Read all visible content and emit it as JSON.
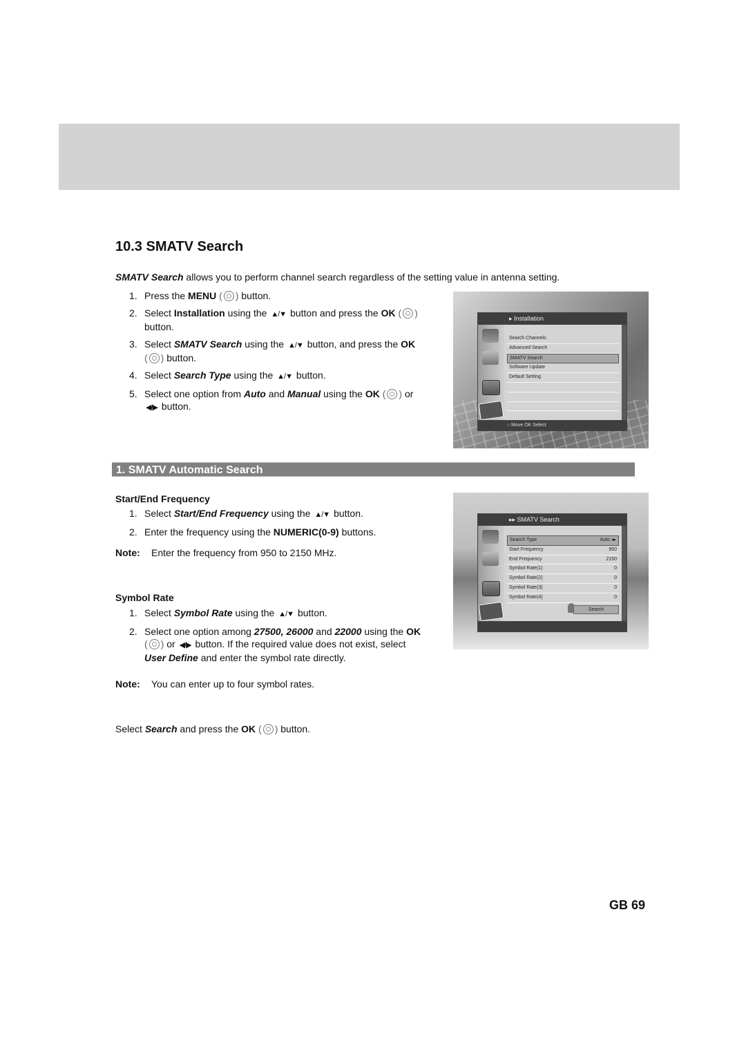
{
  "page": {
    "title": "10.3 SMATV Search",
    "page_number": "GB 69",
    "header_band_color": "#d3d3d3",
    "section_bar_color": "#808080"
  },
  "intro": {
    "lead": "SMATV Search",
    "text": " allows you to perform channel search regardless of the setting value in antenna setting."
  },
  "steps_main": [
    {
      "num": "1.",
      "parts": [
        "Press the ",
        "MENU",
        " button."
      ]
    },
    {
      "num": "2.",
      "parts": [
        "Select ",
        "Installation",
        " using the ",
        " button and press the ",
        "OK",
        " button."
      ]
    },
    {
      "num": "3.",
      "parts": [
        "Select ",
        "SMATV Search",
        " using the ",
        " button, and press the ",
        "OK",
        " button."
      ]
    },
    {
      "num": "4.",
      "parts": [
        "Select ",
        "Search Type",
        " using the ",
        " button."
      ]
    },
    {
      "num": "5.",
      "parts": [
        "Select one option from ",
        "Auto",
        " and ",
        "Manual",
        " using the ",
        "OK",
        " or ",
        " button."
      ]
    }
  ],
  "section": {
    "title": "1. SMATV Automatic Search"
  },
  "start_end": {
    "heading": "Start/End Frequency",
    "steps": [
      {
        "num": "1.",
        "parts": [
          "Select ",
          "Start/End Frequency",
          " using the ",
          " button."
        ]
      },
      {
        "num": "2.",
        "parts": [
          "Enter the frequency using the ",
          "NUMERIC(0-9)",
          " buttons."
        ]
      }
    ],
    "note_label": "Note:",
    "note_text": "Enter the frequency from 950 to 2150 MHz."
  },
  "symbol_rate": {
    "heading": "Symbol Rate",
    "steps": [
      {
        "num": "1.",
        "parts": [
          "Select ",
          "Symbol Rate",
          " using the ",
          " button."
        ]
      },
      {
        "num": "2.",
        "parts": [
          "Select one option among ",
          "27500, 26000",
          " and ",
          "22000",
          " using the ",
          "OK",
          " or ",
          " button. If the required value does not exist, select ",
          "User Define",
          " and enter the symbol rate directly."
        ]
      }
    ],
    "note_label": "Note:",
    "note_text": "You can enter up to four symbol rates."
  },
  "final": {
    "parts": [
      "Select ",
      "Search",
      " and press the ",
      "OK",
      " button."
    ]
  },
  "icons": {
    "up_down": "▲/▼",
    "left_right": "◀/▶"
  },
  "screen1": {
    "title": "▸ Installation",
    "items": [
      "Search Channels",
      "Advanced Search",
      "SMATV Search",
      "Software Update",
      "Default Setting",
      "",
      "",
      "",
      ""
    ],
    "selected_index": 2,
    "footer": "○ Move   OK Select"
  },
  "screen2": {
    "title": "▸▸ SMATV Search",
    "rows": [
      {
        "label": "Search Type",
        "value": "Auto ◂▸"
      },
      {
        "label": "Start Frequency",
        "value": "950"
      },
      {
        "label": "End Frequency",
        "value": "2150"
      },
      {
        "label": "Symbol Rate(1)",
        "value": "0"
      },
      {
        "label": "Symbol Rate(2)",
        "value": "0"
      },
      {
        "label": "Symbol Rate(3)",
        "value": "0"
      },
      {
        "label": "Symbol Rate(4)",
        "value": "0"
      }
    ],
    "selected_index": 0,
    "search_button": "Search"
  }
}
